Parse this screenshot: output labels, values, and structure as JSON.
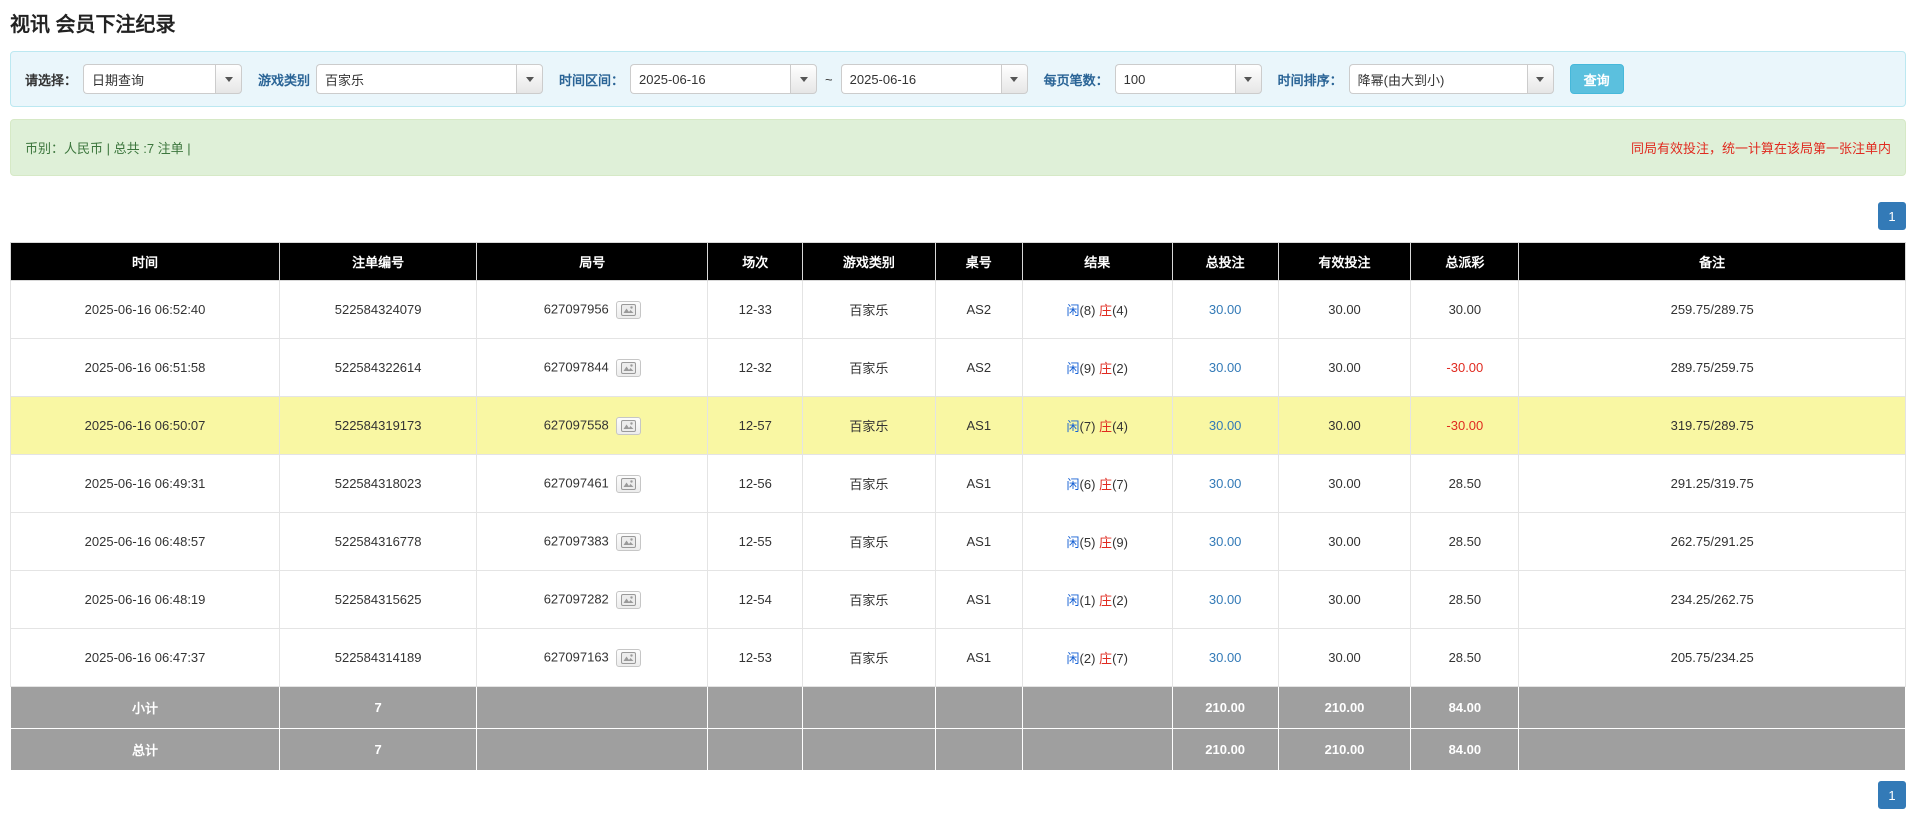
{
  "page": {
    "title": "视讯 会员下注纪录"
  },
  "filters": {
    "select_label": "请选择：",
    "select_value": "日期查询",
    "game_label": "游戏类别",
    "game_value": "百家乐",
    "range_label": "时间区间：",
    "range_start": "2025-06-16",
    "range_separator": "~",
    "range_end": "2025-06-16",
    "page_size_label": "每页笔数：",
    "page_size_value": "100",
    "sort_label": "时间排序：",
    "sort_value": "降幂(由大到小)",
    "search_button": "查询"
  },
  "summary": {
    "left": "币别：人民币 | 总共 :7 注单 |",
    "right": "同局有效投注，统一计算在该局第一张注单内"
  },
  "pagination": {
    "page": "1"
  },
  "table": {
    "headers": [
      "时间",
      "注单编号",
      "局号",
      "场次",
      "游戏类别",
      "桌号",
      "结果",
      "总投注",
      "有效投注",
      "总派彩",
      "备注"
    ],
    "result_player_label": "闲",
    "result_banker_label": "庄",
    "rows": [
      {
        "time": "2025-06-16 06:52:40",
        "bet_no": "522584324079",
        "round_no": "627097956",
        "session": "12-33",
        "game": "百家乐",
        "table_no": "AS2",
        "player_num": "8",
        "banker_num": "4",
        "total_bet": "30.00",
        "valid_bet": "30.00",
        "payout": "30.00",
        "remark": "259.75/289.75",
        "highlight": false
      },
      {
        "time": "2025-06-16 06:51:58",
        "bet_no": "522584322614",
        "round_no": "627097844",
        "session": "12-32",
        "game": "百家乐",
        "table_no": "AS2",
        "player_num": "9",
        "banker_num": "2",
        "total_bet": "30.00",
        "valid_bet": "30.00",
        "payout": "-30.00",
        "remark": "289.75/259.75",
        "highlight": false
      },
      {
        "time": "2025-06-16 06:50:07",
        "bet_no": "522584319173",
        "round_no": "627097558",
        "session": "12-57",
        "game": "百家乐",
        "table_no": "AS1",
        "player_num": "7",
        "banker_num": "4",
        "total_bet": "30.00",
        "valid_bet": "30.00",
        "payout": "-30.00",
        "remark": "319.75/289.75",
        "highlight": true
      },
      {
        "time": "2025-06-16 06:49:31",
        "bet_no": "522584318023",
        "round_no": "627097461",
        "session": "12-56",
        "game": "百家乐",
        "table_no": "AS1",
        "player_num": "6",
        "banker_num": "7",
        "total_bet": "30.00",
        "valid_bet": "30.00",
        "payout": "28.50",
        "remark": "291.25/319.75",
        "highlight": false
      },
      {
        "time": "2025-06-16 06:48:57",
        "bet_no": "522584316778",
        "round_no": "627097383",
        "session": "12-55",
        "game": "百家乐",
        "table_no": "AS1",
        "player_num": "5",
        "banker_num": "9",
        "total_bet": "30.00",
        "valid_bet": "30.00",
        "payout": "28.50",
        "remark": "262.75/291.25",
        "highlight": false
      },
      {
        "time": "2025-06-16 06:48:19",
        "bet_no": "522584315625",
        "round_no": "627097282",
        "session": "12-54",
        "game": "百家乐",
        "table_no": "AS1",
        "player_num": "1",
        "banker_num": "2",
        "total_bet": "30.00",
        "valid_bet": "30.00",
        "payout": "28.50",
        "remark": "234.25/262.75",
        "highlight": false
      },
      {
        "time": "2025-06-16 06:47:37",
        "bet_no": "522584314189",
        "round_no": "627097163",
        "session": "12-53",
        "game": "百家乐",
        "table_no": "AS1",
        "player_num": "2",
        "banker_num": "7",
        "total_bet": "30.00",
        "valid_bet": "30.00",
        "payout": "28.50",
        "remark": "205.75/234.25",
        "highlight": false
      }
    ],
    "footer": [
      {
        "label": "小计",
        "count": "7",
        "total_bet": "210.00",
        "valid_bet": "210.00",
        "payout": "84.00"
      },
      {
        "label": "总计",
        "count": "7",
        "total_bet": "210.00",
        "valid_bet": "210.00",
        "payout": "84.00"
      }
    ]
  },
  "colors": {
    "label-blue": "#2a6496",
    "filter-bg": "#eaf6fb",
    "filter-border": "#bce8f1",
    "search-button": "#5bc0de",
    "summary-bg": "#dff0d8",
    "summary-border": "#d6e9c6",
    "summary-text": "#3c763d",
    "note-red": "#e02b20",
    "pagination-active": "#337ab7",
    "header-bg": "#000000",
    "footer-bg": "#9f9f9f",
    "highlight-row": "#f9f7a3",
    "player": "#1560d4",
    "banker": "#e02b20",
    "negative": "#e02b20",
    "link": "#337ab7"
  }
}
